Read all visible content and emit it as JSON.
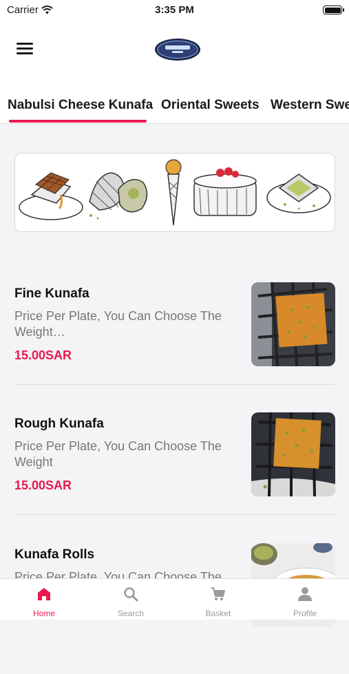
{
  "status_bar": {
    "carrier": "Carrier",
    "time": "3:35 PM"
  },
  "header": {
    "menu_icon": "hamburger-menu-icon",
    "logo": "brand-logo"
  },
  "tabs": [
    {
      "label": "Nabulsi Cheese Kunafa",
      "active": true
    },
    {
      "label": "Oriental Sweets",
      "active": false
    },
    {
      "label": "Western Swe",
      "active": false
    }
  ],
  "banner": {
    "icons": [
      "waffle-icon",
      "croissant-icon",
      "ice-cream-cone-icon",
      "cake-icon",
      "kunafa-plate-icon"
    ]
  },
  "products": [
    {
      "name": "Fine Kunafa",
      "description": "Price Per Plate, You Can Choose The Weight…",
      "price": "15.00SAR"
    },
    {
      "name": "Rough Kunafa",
      "description": "Price Per Plate, You Can Choose The Weight",
      "price": "15.00SAR"
    },
    {
      "name": "Kunafa Rolls",
      "description": "Price Per Plate, You Can Choose The",
      "price": ""
    }
  ],
  "bottom_nav": [
    {
      "label": "Home",
      "icon": "home-icon",
      "active": true
    },
    {
      "label": "Search",
      "icon": "search-icon",
      "active": false
    },
    {
      "label": "Basket",
      "icon": "cart-icon",
      "active": false
    },
    {
      "label": "Profile",
      "icon": "profile-icon",
      "active": false
    }
  ],
  "colors": {
    "accent": "#e8194f",
    "background": "#f4f4f6"
  }
}
